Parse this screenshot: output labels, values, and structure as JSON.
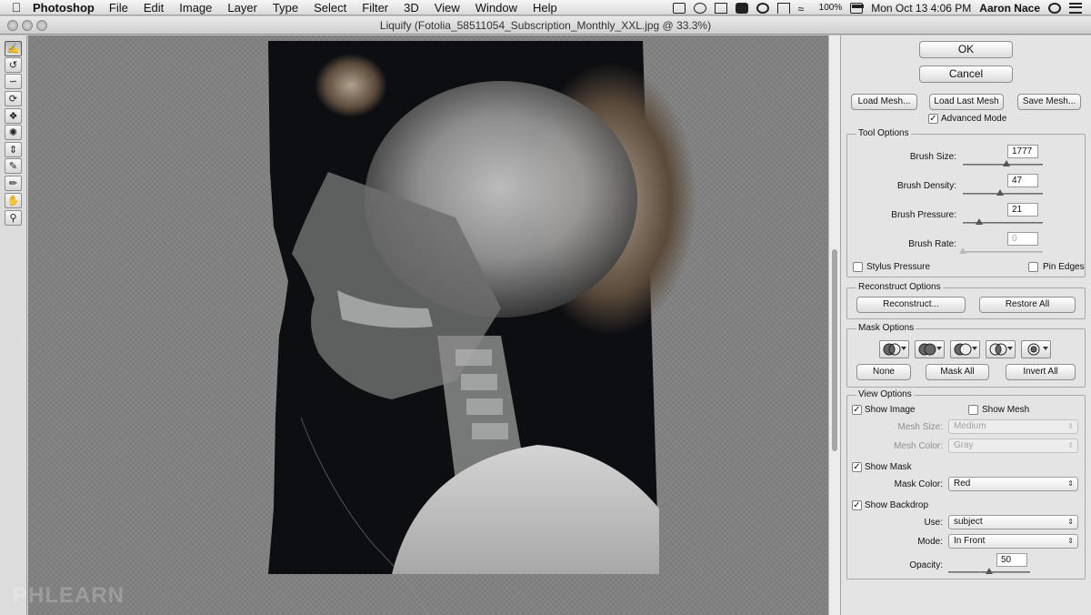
{
  "menubar": {
    "app_name": "Photoshop",
    "menus": [
      "File",
      "Edit",
      "Image",
      "Layer",
      "Type",
      "Select",
      "Filter",
      "3D",
      "View",
      "Window",
      "Help"
    ],
    "battery": "100%",
    "datetime": "Mon Oct 13  4:06 PM",
    "user": "Aaron Nace"
  },
  "window": {
    "title": "Liquify (Fotolia_58511054_Subscription_Monthly_XXL.jpg @ 33.3%)"
  },
  "tools": [
    "forward-warp-tool",
    "reconstruct-tool",
    "smooth-tool",
    "twirl-clockwise-tool",
    "pucker-tool",
    "bloat-tool",
    "push-left-tool",
    "freeze-mask-tool",
    "thaw-mask-tool",
    "hand-tool",
    "zoom-tool"
  ],
  "watermark": "PHLEARN",
  "panel": {
    "ok_label": "OK",
    "cancel_label": "Cancel",
    "load_mesh_label": "Load Mesh...",
    "load_last_mesh_label": "Load Last Mesh",
    "save_mesh_label": "Save Mesh...",
    "advanced_mode_label": "Advanced Mode",
    "advanced_mode_checked": true,
    "tool_options": {
      "title": "Tool Options",
      "brush_size_label": "Brush Size:",
      "brush_size": "1777",
      "brush_size_level": 0.55,
      "brush_density_label": "Brush Density:",
      "brush_density": "47",
      "brush_density_level": 0.47,
      "brush_pressure_label": "Brush Pressure:",
      "brush_pressure": "21",
      "brush_pressure_level": 0.21,
      "brush_rate_label": "Brush Rate:",
      "brush_rate": "0",
      "brush_rate_level": 0,
      "stylus_pressure_label": "Stylus Pressure",
      "stylus_pressure_checked": false,
      "pin_edges_label": "Pin Edges",
      "pin_edges_checked": false
    },
    "reconstruct_options": {
      "title": "Reconstruct Options",
      "reconstruct_label": "Reconstruct...",
      "restore_all_label": "Restore All"
    },
    "mask_options": {
      "title": "Mask Options",
      "none_label": "None",
      "mask_all_label": "Mask All",
      "invert_all_label": "Invert All"
    },
    "view_options": {
      "title": "View Options",
      "show_image_label": "Show Image",
      "show_image_checked": true,
      "show_mesh_label": "Show Mesh",
      "show_mesh_checked": false,
      "mesh_size_label": "Mesh Size:",
      "mesh_size": "Medium",
      "mesh_color_label": "Mesh Color:",
      "mesh_color": "Gray",
      "show_mask_label": "Show Mask",
      "show_mask_checked": true,
      "mask_color_label": "Mask Color:",
      "mask_color": "Red",
      "show_backdrop_label": "Show Backdrop",
      "show_backdrop_checked": true,
      "use_label": "Use:",
      "use_value": "subject",
      "mode_label": "Mode:",
      "mode_value": "In Front",
      "opacity_label": "Opacity:",
      "opacity": "50",
      "opacity_level": 0.5
    }
  }
}
